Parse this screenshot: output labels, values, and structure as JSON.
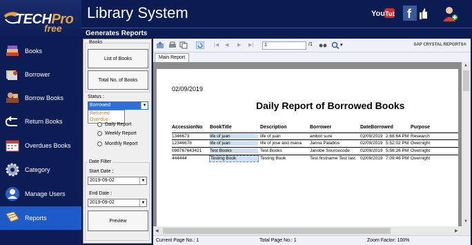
{
  "logo": {
    "tech": "TECH",
    "pro": "Pro",
    "free": "free"
  },
  "header": {
    "title": "Library System"
  },
  "sub": {
    "title": "Generates Reports"
  },
  "nav": [
    {
      "label": "Books",
      "icon": "books-icon"
    },
    {
      "label": "Borrower",
      "icon": "borrower-icon"
    },
    {
      "label": "Borrow Books",
      "icon": "borrow-books-icon"
    },
    {
      "label": "Return Books",
      "icon": "return-arrow-icon"
    },
    {
      "label": "Overdues Books",
      "icon": "calendar-icon"
    },
    {
      "label": "Category",
      "icon": "gear-icon"
    },
    {
      "label": "Manage Users",
      "icon": "user-icon"
    },
    {
      "label": "Reports",
      "icon": "reports-icon"
    }
  ],
  "panel": {
    "books_group": "Books",
    "list_of_books": "List of Books",
    "total_books": "Total No. of Books",
    "status_label": "Status :",
    "status_value": "Borrowed",
    "status_options": [
      "Returned",
      "Overdue"
    ],
    "daily": "Daily Report",
    "weekly": "Weekly Report",
    "monthly": "Monthly Report",
    "date_filter": "Date Filter",
    "start_label": "Start Date :",
    "start_value": "2019-09-02",
    "end_label": "End Date :",
    "end_value": "2019-09-02",
    "preview": "Preview"
  },
  "toolbar": {
    "page_value": "1",
    "page_of": "/1",
    "crystal": "SAP CRYSTAL REPORTS®"
  },
  "tabs": {
    "main": "Main Report"
  },
  "report": {
    "date": "02/09/2019",
    "title": "Daily Report of Borrowed Books",
    "columns": [
      "AccessionNo",
      "BookTitle",
      "Description",
      "Borrower",
      "DateBorrowed",
      "Purpose"
    ],
    "rows": [
      [
        "1346673",
        "life of juan",
        "life of juan",
        "ambot sure",
        "02/09/2019",
        "2:68:64 PM",
        "Research"
      ],
      [
        "12346678",
        "life of juan",
        "life of jose and mana",
        "Janna Palabos",
        "02/09/2019",
        "5:52:02 PM",
        "Overnight"
      ],
      [
        "098767643421",
        "Test Books",
        "Test Books",
        "Janobe Sourcecode",
        "02/09/2019",
        "5:56:26 PM",
        "Overnight"
      ],
      [
        "444444",
        "Testing Book",
        "Testing Book",
        "Test firstname Test last",
        "02/09/2019",
        "7:09:46 PM",
        "Overnight"
      ]
    ]
  },
  "status": {
    "current_page": "Current Page No.: 1",
    "total_page": "Total Page No.: 1",
    "zoom": "Zoom Factor: 100%"
  }
}
